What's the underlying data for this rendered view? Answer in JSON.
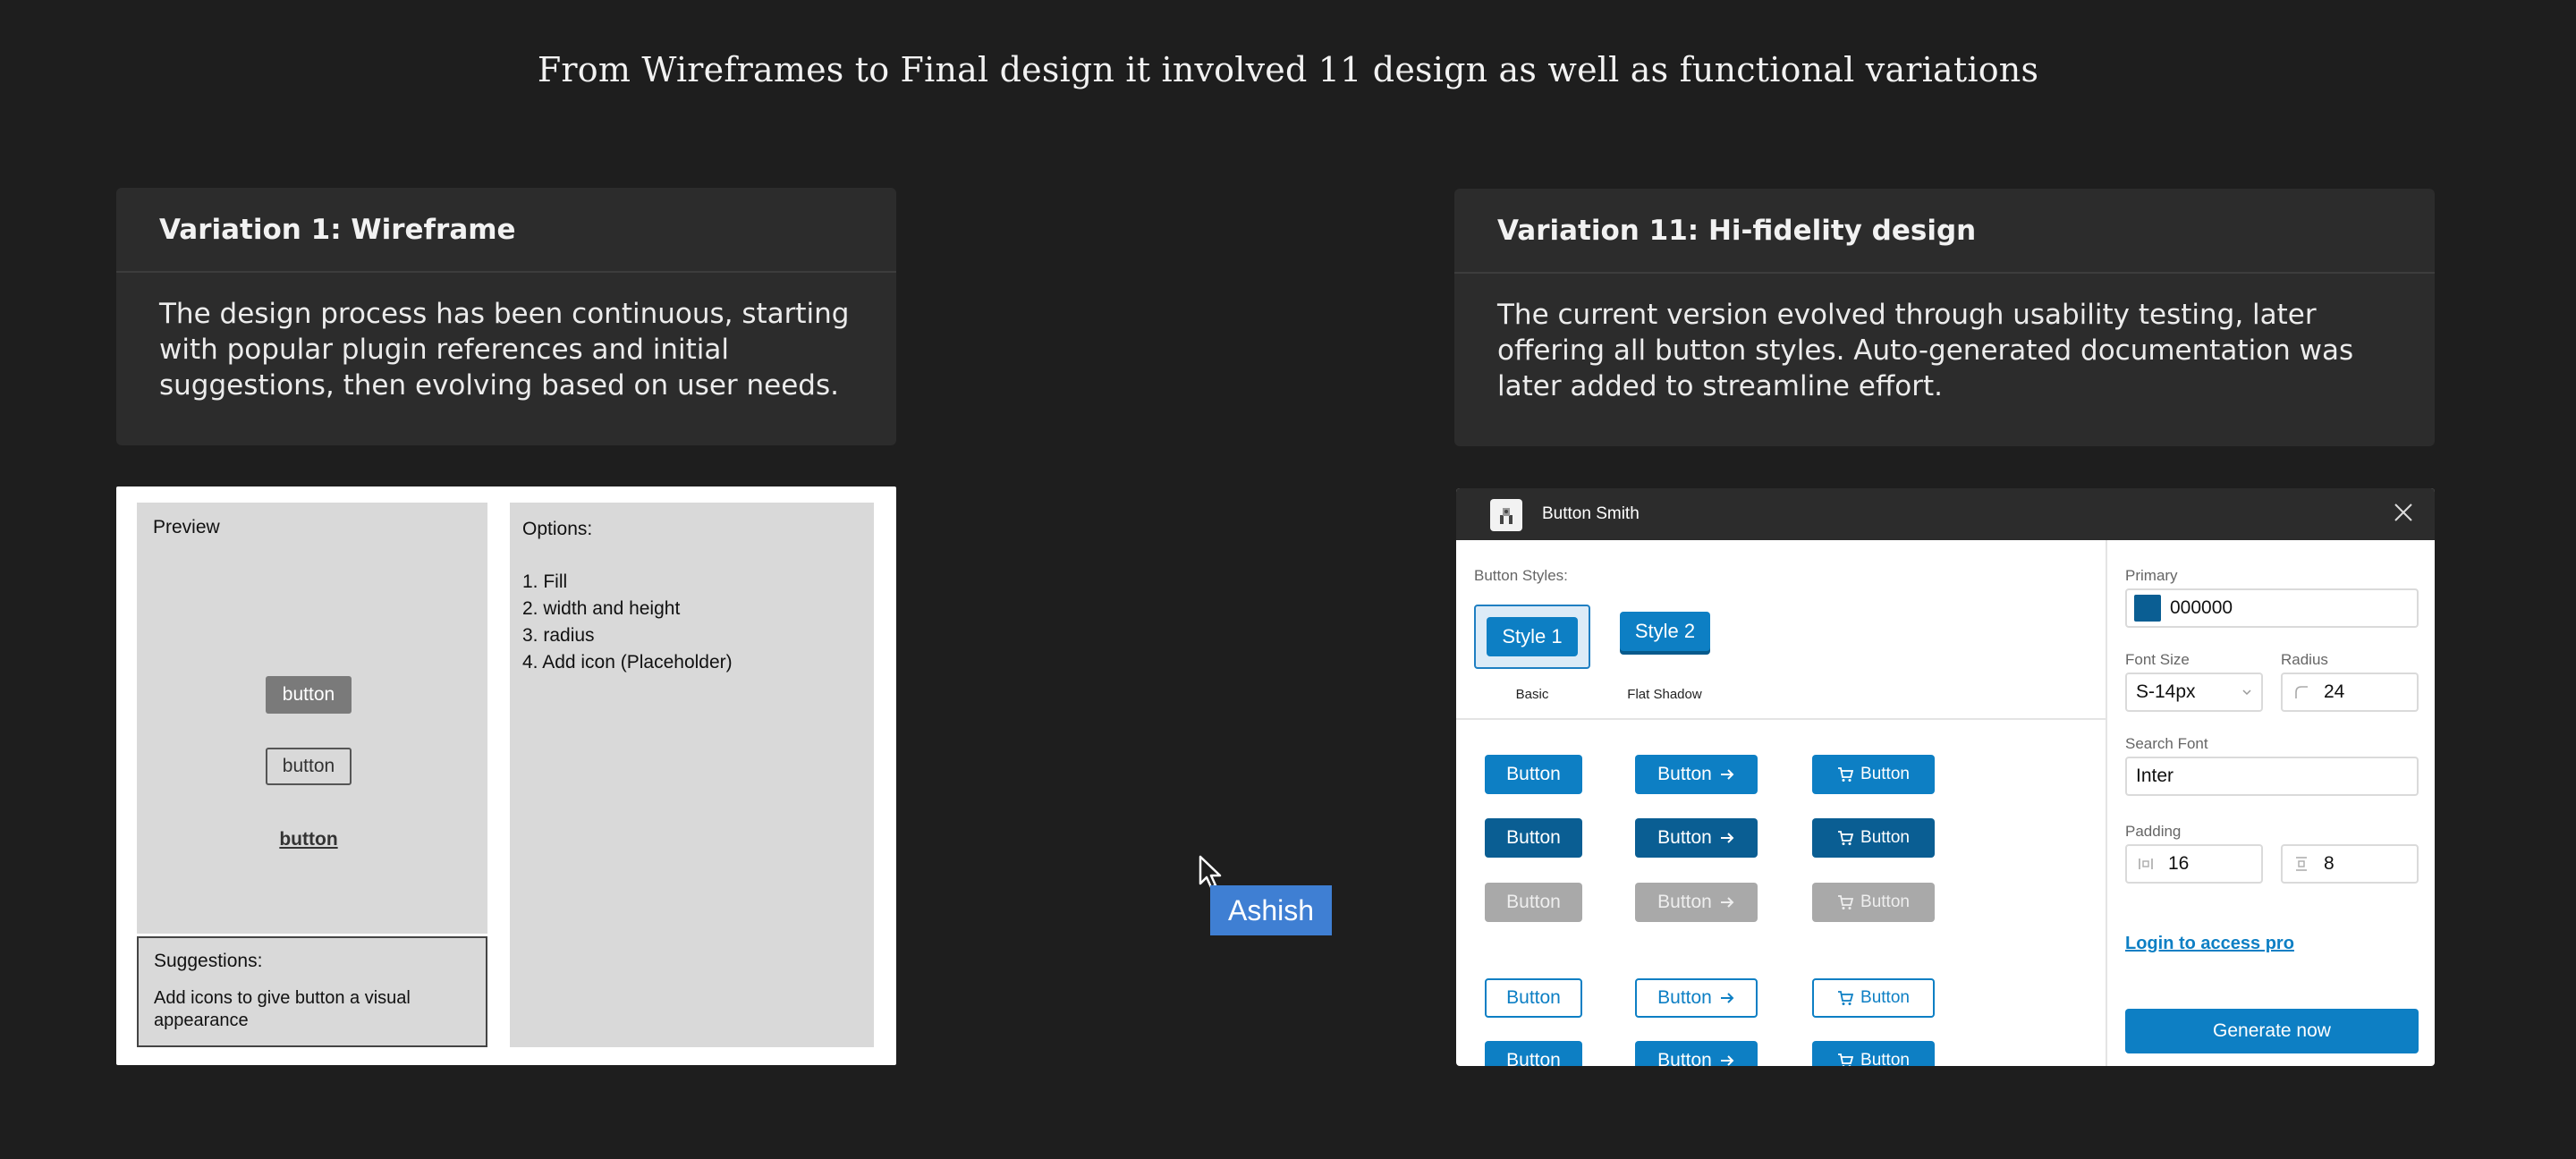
{
  "headline": "From Wireframes to Final design it involved 11 design as well as functional variations",
  "left_card": {
    "title": "Variation 1: Wireframe",
    "body": "The design process has been continuous, starting with popular plugin references and initial suggestions, then evolving based on user needs."
  },
  "right_card": {
    "title": "Variation 11: Hi-fidelity design",
    "body": "The current version evolved through usability testing, later offering all button styles. Auto-generated documentation was later added to streamline effort."
  },
  "wireframe": {
    "preview_label": "Preview",
    "buttons": [
      "button",
      "button",
      "button"
    ],
    "options_label": "Options:",
    "options": [
      "1. Fill",
      "2. width and height",
      "3. radius",
      "4. Add icon (Placeholder)"
    ],
    "suggestions_label": "Suggestions:",
    "suggestions_text": "Add icons to give button a visual appearance"
  },
  "cursor": {
    "name": "Ashish"
  },
  "plugin": {
    "title": "Button Smith",
    "styles_label": "Button Styles:",
    "style1": {
      "label": "Style 1",
      "caption": "Basic"
    },
    "style2": {
      "label": "Style 2",
      "caption": "Flat Shadow"
    },
    "button_label": "Button",
    "fields": {
      "primary_label": "Primary",
      "primary_value": "000000",
      "font_size_label": "Font Size",
      "font_size_value": "S-14px",
      "radius_label": "Radius",
      "radius_value": "24",
      "search_font_label": "Search Font",
      "search_font_value": "Inter",
      "padding_label": "Padding",
      "padding_h": "16",
      "padding_v": "8"
    },
    "login_link": "Login to access pro",
    "generate_label": "Generate now",
    "colors": {
      "primary": "#0d7fc4",
      "dark": "#0a5e93",
      "disabled": "#a9a9a9"
    }
  }
}
